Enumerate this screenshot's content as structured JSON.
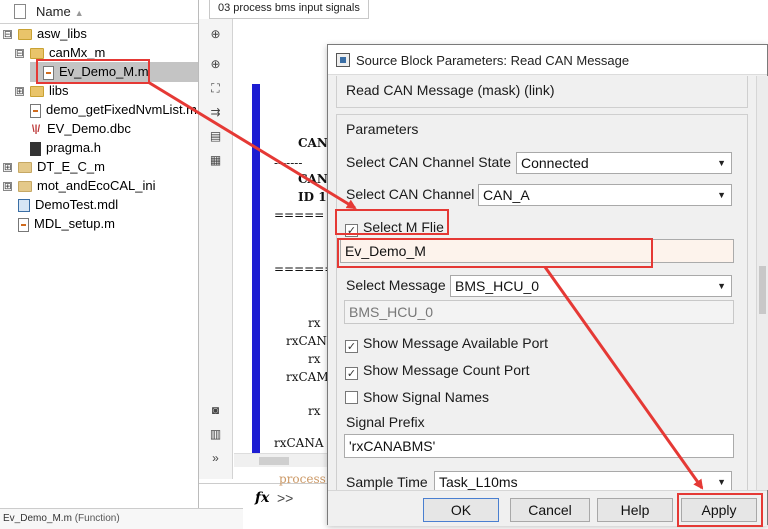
{
  "tree": {
    "header": "Name",
    "items": [
      {
        "label": "asw_libs",
        "kind": "folder",
        "expander": "⊟"
      },
      {
        "label": "canMx_m",
        "kind": "folder",
        "expander": "⊟"
      },
      {
        "label": "Ev_Demo_M.m",
        "kind": "m-file",
        "selected": true
      },
      {
        "label": "libs",
        "kind": "folder",
        "expander": "⊞"
      },
      {
        "label": "demo_getFixedNvmList.m",
        "kind": "m-file"
      },
      {
        "label": "EV_Demo.dbc",
        "kind": "dbc-file"
      },
      {
        "label": "pragma.h",
        "kind": "header-file"
      },
      {
        "label": "DT_E_C_m",
        "kind": "folder",
        "expander": "⊞"
      },
      {
        "label": "mot_andEcoCAL_ini",
        "kind": "folder",
        "expander": "⊞"
      },
      {
        "label": "DemoTest.mdl",
        "kind": "mdl-file"
      },
      {
        "label": "MDL_setup.m",
        "kind": "m-file"
      }
    ],
    "status": "Ev_Demo_M.m",
    "status_hint": "(Function)"
  },
  "editor": {
    "tab": "03 process bms input signals",
    "code_lines": [
      "CAN",
      "-------",
      "CAN",
      "ID 1",
      "=====",
      "=======",
      "rx",
      "rxCAN",
      "rx",
      "rxCAM",
      "rx",
      "rxCANA"
    ],
    "ghost_text": "process",
    "prompt": ">>",
    "fx": "fx",
    "toolbar_icons": [
      "hide-show-icon",
      "zoom-in-icon",
      "fit-view-icon",
      "arrow-right-icon",
      "annotation-icon",
      "image-icon",
      "camera-icon",
      "checklist-icon",
      "expand-more-icon"
    ],
    "more_glyph": "»"
  },
  "dialog": {
    "title": "Source Block Parameters: Read CAN Message",
    "description": "Read CAN Message (mask) (link)",
    "parameters_label": "Parameters",
    "channel_state": {
      "label": "Select CAN Channel State",
      "value": "Connected"
    },
    "channel": {
      "label": "Select CAN Channel",
      "value": "CAN_A"
    },
    "select_m_file": {
      "label": "Select M Flie",
      "checked": true
    },
    "m_file_value": "Ev_Demo_M",
    "message": {
      "label": "Select Message",
      "value": "BMS_HCU_0"
    },
    "message_readonly": "BMS_HCU_0",
    "show_available_port": {
      "label": "Show Message Available Port",
      "checked": true
    },
    "show_count_port": {
      "label": "Show Message Count Port",
      "checked": true
    },
    "show_signal_names": {
      "label": "Show Signal Names",
      "checked": false
    },
    "signal_prefix": {
      "label": "Signal Prefix",
      "value": "'rxCANABMS'"
    },
    "sample_time": {
      "label": "Sample Time",
      "value": "Task_L10ms"
    },
    "buttons": {
      "ok": "OK",
      "cancel": "Cancel",
      "help": "Help",
      "apply": "Apply"
    }
  },
  "glyphs": {
    "checked": "✓",
    "dropdown": "▼",
    "sort": "▲"
  },
  "colors": {
    "highlight": "#e53935",
    "stateflow_border": "#1c1cd2",
    "folder": "#e9c46a"
  }
}
